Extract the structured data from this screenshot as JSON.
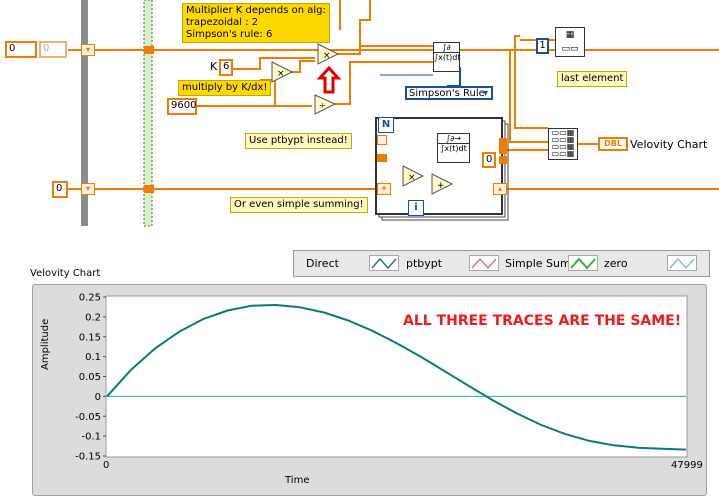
{
  "diagram": {
    "comment_multiplier": [
      "Multiplier K depends on alg:",
      "trapezoidal : 2",
      "Simpson's rule: 6"
    ],
    "k_label": "K",
    "k_value": "6",
    "comment_multiply": "multiply by K/dx!",
    "constant_9600": "9600",
    "comment_ptbypt": "Use ptbypt instead!",
    "comment_summing": "Or even simple summing!",
    "array_index_control": "0",
    "array_value_display": "0",
    "zero_control_left": "0",
    "zero_const_inner": "0",
    "integration_mode": "Simpson's Rule",
    "loop_count_label": "N",
    "loop_iteration_label": "i",
    "array_index_const": "1",
    "comment_last_element": "last element",
    "dbl_terminal": "DBL",
    "chart_terminal_label": "Velovity Chart",
    "colors": {
      "wire_orange": "#f07d00",
      "wire_blue": "#1a4ea0",
      "wire_green": "#2e7d32",
      "note_yellow": "#ffd800",
      "arrow_red": "#e00000"
    }
  },
  "front_panel": {
    "legend": {
      "items": [
        "Direct",
        "ptbypt",
        "Simple Sum",
        "zero"
      ],
      "colors": [
        "#1f3f80",
        "#2a6db0",
        "#d04a4a",
        "#3ab03a"
      ]
    },
    "chart_label": "Velovity Chart",
    "annotation": "ALL THREE TRACES ARE THE SAME!",
    "annotation_color": "#ee1c1c"
  },
  "chart_data": {
    "type": "line",
    "xlabel": "Time",
    "ylabel": "Amplitude",
    "xlim": [
      0,
      47999
    ],
    "ylim": [
      -0.15,
      0.25
    ],
    "x_ticks": [
      "0",
      "47999"
    ],
    "y_ticks": [
      "0.25",
      "0.2",
      "0.15",
      "0.1",
      "0.05",
      "0",
      "-0.05",
      "-0.1",
      "-0.15"
    ],
    "grid": false,
    "series": [
      {
        "name": "Direct",
        "color": "#0b7a74",
        "x": [
          0,
          2000,
          4000,
          6000,
          8000,
          10000,
          12000,
          14000,
          16000,
          18000,
          20000,
          22000,
          24000,
          26000,
          28000,
          30000,
          32000,
          34000,
          36000,
          38000,
          40000,
          42000,
          44000,
          46000,
          47999
        ],
        "y": [
          0.0,
          0.067,
          0.121,
          0.163,
          0.195,
          0.216,
          0.228,
          0.23,
          0.224,
          0.211,
          0.191,
          0.165,
          0.134,
          0.1,
          0.063,
          0.026,
          -0.01,
          -0.043,
          -0.072,
          -0.095,
          -0.112,
          -0.123,
          -0.129,
          -0.132,
          -0.134
        ]
      },
      {
        "name": "zero",
        "color": "#2aa8a0",
        "x": [
          0,
          47999
        ],
        "y": [
          0,
          0
        ]
      }
    ]
  }
}
